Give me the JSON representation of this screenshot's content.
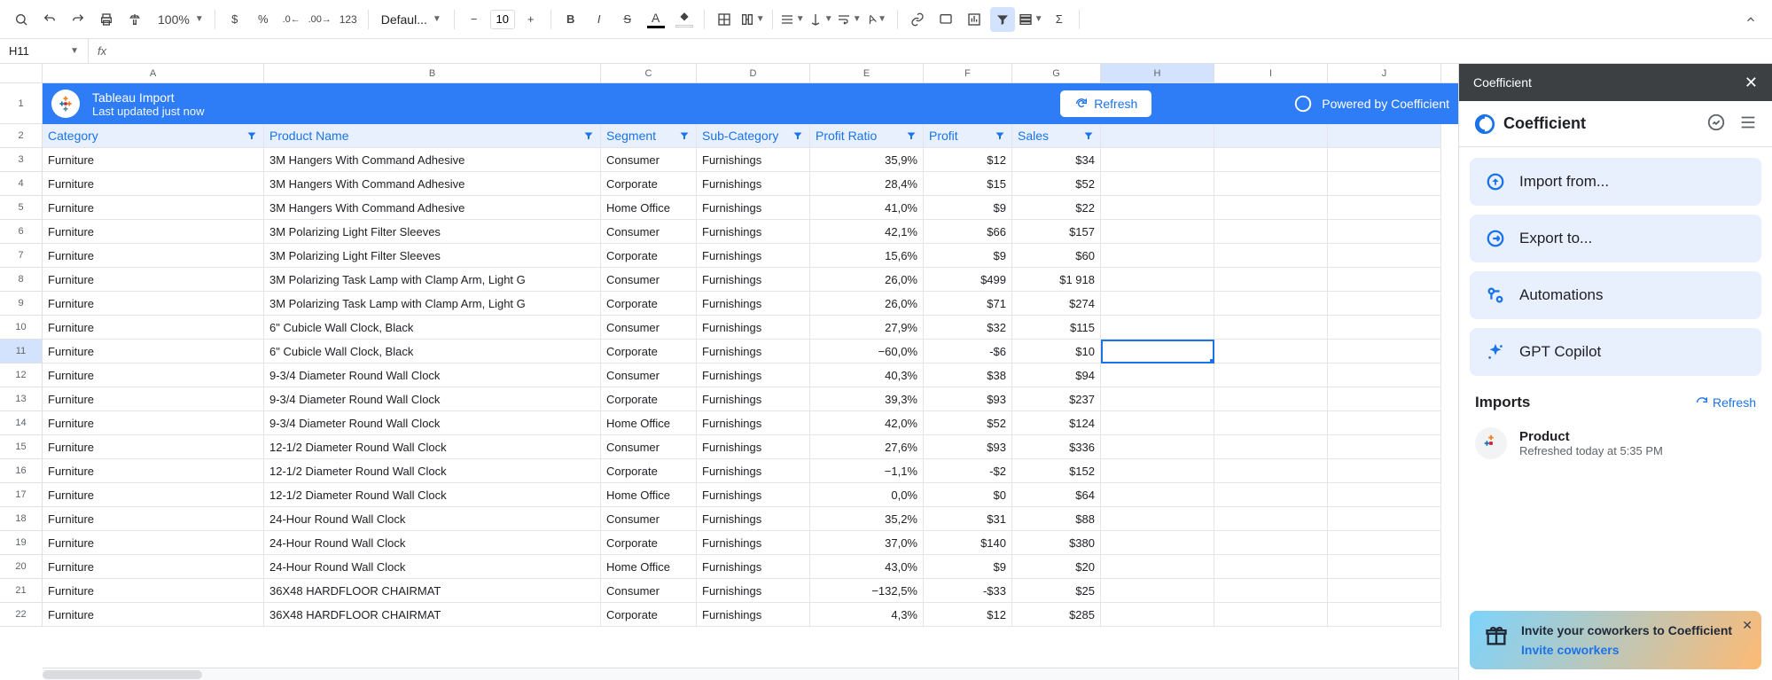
{
  "toolbar": {
    "zoom": "100%",
    "font": "Defaul...",
    "font_size": "10"
  },
  "namebox": "H11",
  "columns": [
    "A",
    "B",
    "C",
    "D",
    "E",
    "F",
    "G",
    "H",
    "I",
    "J"
  ],
  "banner": {
    "title": "Tableau Import",
    "subtitle": "Last updated just now",
    "refresh": "Refresh",
    "powered": "Powered by Coefficient"
  },
  "headers": [
    "Category",
    "Product Name",
    "Segment",
    "Sub-Category",
    "Profit Ratio",
    "Profit",
    "Sales"
  ],
  "rows": [
    {
      "n": 3,
      "a": "Furniture",
      "b": "3M Hangers With Command Adhesive",
      "c": "Consumer",
      "d": "Furnishings",
      "e": "35,9%",
      "f": "$12",
      "g": "$34"
    },
    {
      "n": 4,
      "a": "Furniture",
      "b": "3M Hangers With Command Adhesive",
      "c": "Corporate",
      "d": "Furnishings",
      "e": "28,4%",
      "f": "$15",
      "g": "$52"
    },
    {
      "n": 5,
      "a": "Furniture",
      "b": "3M Hangers With Command Adhesive",
      "c": "Home Office",
      "d": "Furnishings",
      "e": "41,0%",
      "f": "$9",
      "g": "$22"
    },
    {
      "n": 6,
      "a": "Furniture",
      "b": "3M Polarizing Light Filter Sleeves",
      "c": "Consumer",
      "d": "Furnishings",
      "e": "42,1%",
      "f": "$66",
      "g": "$157"
    },
    {
      "n": 7,
      "a": "Furniture",
      "b": "3M Polarizing Light Filter Sleeves",
      "c": "Corporate",
      "d": "Furnishings",
      "e": "15,6%",
      "f": "$9",
      "g": "$60"
    },
    {
      "n": 8,
      "a": "Furniture",
      "b": "3M Polarizing Task Lamp with Clamp Arm, Light G",
      "c": "Consumer",
      "d": "Furnishings",
      "e": "26,0%",
      "f": "$499",
      "g": "$1 918"
    },
    {
      "n": 9,
      "a": "Furniture",
      "b": "3M Polarizing Task Lamp with Clamp Arm, Light G",
      "c": "Corporate",
      "d": "Furnishings",
      "e": "26,0%",
      "f": "$71",
      "g": "$274"
    },
    {
      "n": 10,
      "a": "Furniture",
      "b": "6\" Cubicle Wall Clock, Black",
      "c": "Consumer",
      "d": "Furnishings",
      "e": "27,9%",
      "f": "$32",
      "g": "$115"
    },
    {
      "n": 11,
      "a": "Furniture",
      "b": "6\" Cubicle Wall Clock, Black",
      "c": "Corporate",
      "d": "Furnishings",
      "e": "−60,0%",
      "f": "-$6",
      "g": "$10"
    },
    {
      "n": 12,
      "a": "Furniture",
      "b": "9-3/4 Diameter Round Wall Clock",
      "c": "Consumer",
      "d": "Furnishings",
      "e": "40,3%",
      "f": "$38",
      "g": "$94"
    },
    {
      "n": 13,
      "a": "Furniture",
      "b": "9-3/4 Diameter Round Wall Clock",
      "c": "Corporate",
      "d": "Furnishings",
      "e": "39,3%",
      "f": "$93",
      "g": "$237"
    },
    {
      "n": 14,
      "a": "Furniture",
      "b": "9-3/4 Diameter Round Wall Clock",
      "c": "Home Office",
      "d": "Furnishings",
      "e": "42,0%",
      "f": "$52",
      "g": "$124"
    },
    {
      "n": 15,
      "a": "Furniture",
      "b": "12-1/2 Diameter Round Wall Clock",
      "c": "Consumer",
      "d": "Furnishings",
      "e": "27,6%",
      "f": "$93",
      "g": "$336"
    },
    {
      "n": 16,
      "a": "Furniture",
      "b": "12-1/2 Diameter Round Wall Clock",
      "c": "Corporate",
      "d": "Furnishings",
      "e": "−1,1%",
      "f": "-$2",
      "g": "$152"
    },
    {
      "n": 17,
      "a": "Furniture",
      "b": "12-1/2 Diameter Round Wall Clock",
      "c": "Home Office",
      "d": "Furnishings",
      "e": "0,0%",
      "f": "$0",
      "g": "$64"
    },
    {
      "n": 18,
      "a": "Furniture",
      "b": "24-Hour Round Wall Clock",
      "c": "Consumer",
      "d": "Furnishings",
      "e": "35,2%",
      "f": "$31",
      "g": "$88"
    },
    {
      "n": 19,
      "a": "Furniture",
      "b": "24-Hour Round Wall Clock",
      "c": "Corporate",
      "d": "Furnishings",
      "e": "37,0%",
      "f": "$140",
      "g": "$380"
    },
    {
      "n": 20,
      "a": "Furniture",
      "b": "24-Hour Round Wall Clock",
      "c": "Home Office",
      "d": "Furnishings",
      "e": "43,0%",
      "f": "$9",
      "g": "$20"
    },
    {
      "n": 21,
      "a": "Furniture",
      "b": "36X48 HARDFLOOR CHAIRMAT",
      "c": "Consumer",
      "d": "Furnishings",
      "e": "−132,5%",
      "f": "-$33",
      "g": "$25"
    },
    {
      "n": 22,
      "a": "Furniture",
      "b": "36X48 HARDFLOOR CHAIRMAT",
      "c": "Corporate",
      "d": "Furnishings",
      "e": "4,3%",
      "f": "$12",
      "g": "$285"
    }
  ],
  "sidebar": {
    "title": "Coefficient",
    "brand": "Coefficient",
    "menu": {
      "import": "Import from...",
      "export": "Export to...",
      "automations": "Automations",
      "gpt": "GPT Copilot"
    },
    "imports_title": "Imports",
    "refresh": "Refresh",
    "import_item": {
      "name": "Product",
      "sub": "Refreshed today at 5:35 PM"
    },
    "invite": {
      "title": "Invite your coworkers to Coefficient",
      "link": "Invite coworkers"
    }
  }
}
